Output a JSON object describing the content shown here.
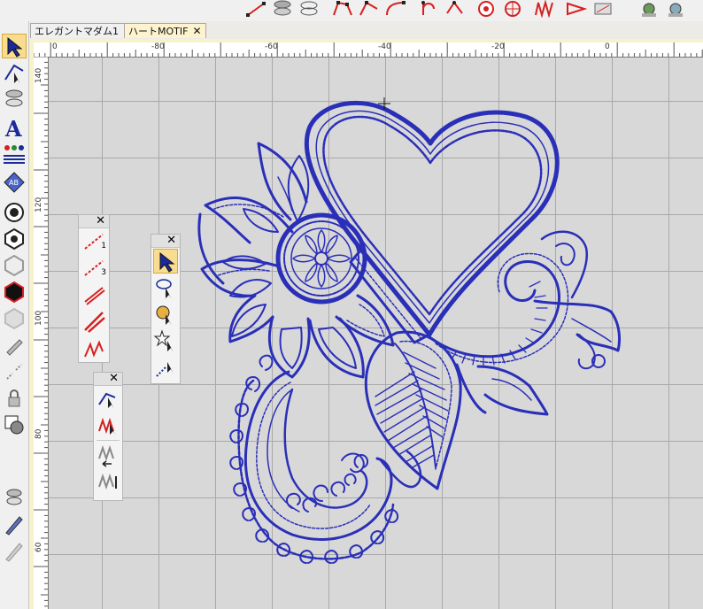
{
  "tabs": [
    {
      "label": "エレガントマダム1",
      "close": "✕",
      "active": false
    },
    {
      "label": "ハートMOTIF",
      "close": "✕",
      "active": true
    }
  ],
  "ruler": {
    "h": [
      "-80",
      "-60",
      "-40",
      "-20",
      "0"
    ],
    "v": [
      "140",
      "120",
      "100",
      "80",
      "60"
    ]
  },
  "palette_close": "✕",
  "palette_line_labels": [
    "1",
    "3"
  ],
  "colors": {
    "thread": "#2a2fb8",
    "grid": "#a9a9a9",
    "canvas": "#d8d8d8",
    "selected": "#f8dc90"
  },
  "icons": {
    "toolbar": [
      "line-tool-icon",
      "spool-icon",
      "spool-outline-icon",
      "polygon-node-icon",
      "node-edit-icon",
      "curve-icon",
      "bezier-icon",
      "rotate-node-icon",
      "circle-stitch-icon",
      "spiral-icon",
      "wave-icon",
      "arrow-point-icon",
      "machine-icon",
      "gear-machine-icon"
    ],
    "left": [
      "select-arrow-icon",
      "node-select-icon",
      "spool-tool-icon",
      "text-a-icon",
      "people-icon",
      "gem-icon",
      "target-icon",
      "hexagon-icon",
      "hexagon-outline-icon",
      "hexagon-filled-icon",
      "hexagon-gray-icon",
      "pen-icon",
      "dots-icon",
      "lock-icon",
      "shape-fill-icon",
      "spool-small-icon",
      "pencil-blue-icon",
      "pencil-gray-icon"
    ]
  }
}
